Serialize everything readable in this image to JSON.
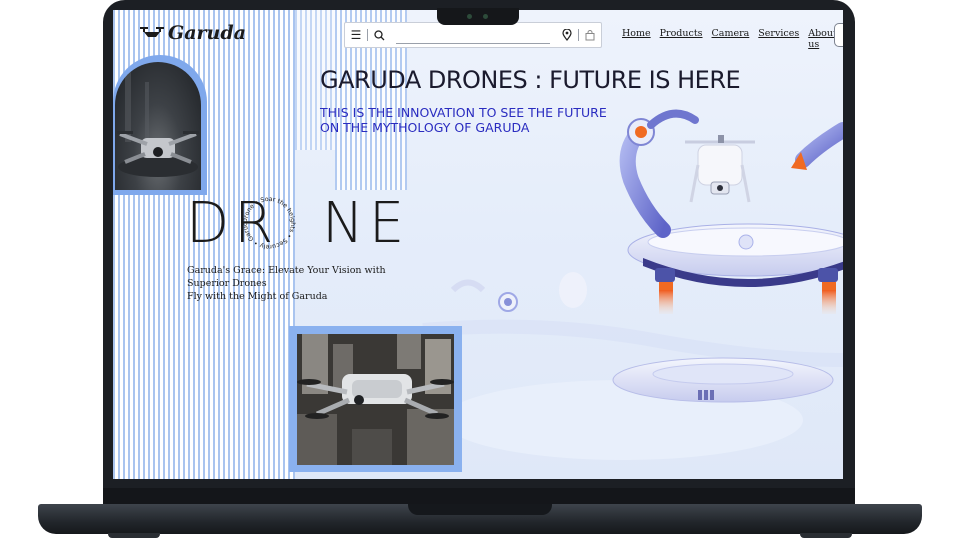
{
  "brand": {
    "name": "Garuda"
  },
  "search": {
    "value": "",
    "placeholder": ""
  },
  "nav": {
    "items": [
      {
        "label": "Home"
      },
      {
        "label": "Products"
      },
      {
        "label": "Camera"
      },
      {
        "label": "Services"
      },
      {
        "label": "About us"
      }
    ]
  },
  "hero": {
    "title": "GARUDA DRONES : FUTURE IS HERE",
    "subtitle": "THIS IS THE INNOVATION TO SEE THE FUTURE ON THE MYTHOLOGY OF GARUDA"
  },
  "feature": {
    "word_left": "DR",
    "word_right": "NE",
    "circle_text": "Drone • Soar the heights • Securely • Garuda •",
    "tagline_lines": [
      "Garuda's Grace: Elevate Your Vision with",
      "Superior Drones",
      "Fly with the Might of Garuda"
    ]
  },
  "colors": {
    "accent_blue": "#8ab1ef",
    "stripe_blue": "#a9c4ef",
    "subtitle_blue": "#2a2cc0",
    "thruster_orange": "#f06a22"
  },
  "icons": [
    "drone-logo-icon",
    "menu-icon",
    "search-icon",
    "location-pin-icon",
    "shopping-bag-icon"
  ]
}
